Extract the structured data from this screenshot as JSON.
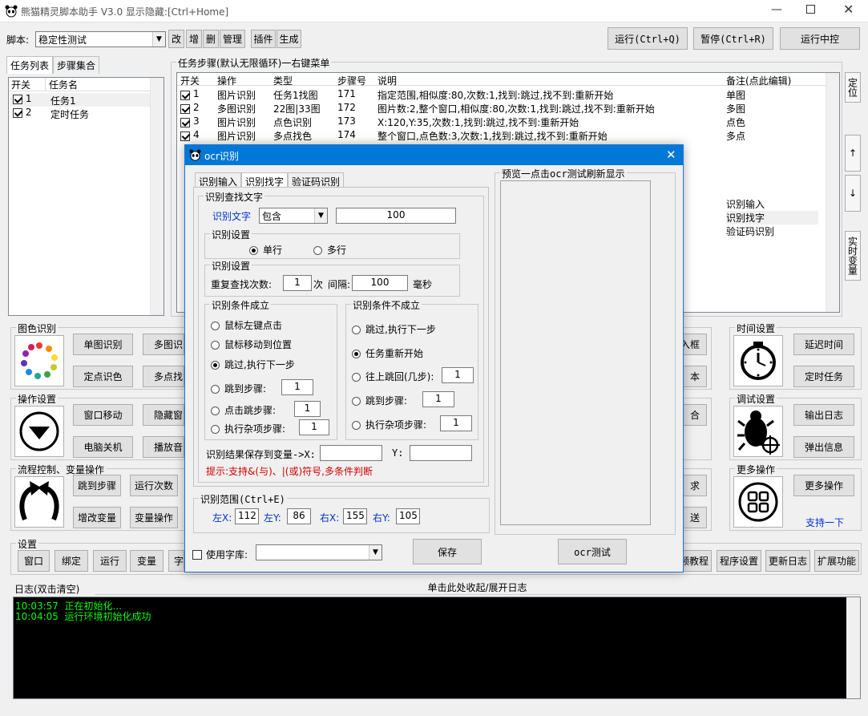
{
  "window": {
    "title": "熊猫精灵脚本助手  V3.0  显示隐藏:[Ctrl+Home]"
  },
  "toolbar": {
    "script_label": "脚本:",
    "script_value": "稳定性测试",
    "buttons": [
      "改",
      "增",
      "删",
      "管理",
      "插件",
      "生成"
    ],
    "run": "运行(Ctrl+Q)",
    "pause": "暂停(Ctrl+R)",
    "stop": "运行中控"
  },
  "left_tabs": [
    "任务列表",
    "步骤集合"
  ],
  "task_list": {
    "headers": [
      "开关",
      "任务名"
    ],
    "rows": [
      {
        "num": "1",
        "name": "任务1",
        "checked": true
      },
      {
        "num": "2",
        "name": "定时任务",
        "checked": true
      }
    ]
  },
  "steps": {
    "group_title": "任务步骤(默认无限循环)一右键菜单",
    "headers": [
      "开关",
      "操作",
      "类型",
      "步骤号",
      "说明",
      "备注(点此编辑)"
    ],
    "rows": [
      {
        "num": "1",
        "op": "图片识别",
        "type": "任务1找图",
        "step": "171",
        "desc": "指定范围,相似度:80,次数:1,找到:跳过,找不到:重新开始",
        "note": "单图"
      },
      {
        "num": "2",
        "op": "多图识别",
        "type": "22图|33图",
        "step": "172",
        "desc": "图片数:2,整个窗口,相似度:80,次数:1,找到:跳过,找不到:重新开始",
        "note": "多图"
      },
      {
        "num": "3",
        "op": "图片识别",
        "type": "点色识别",
        "step": "173",
        "desc": "X:120,Y:35,次数:1,找到:跳过,找不到:重新开始",
        "note": "点色"
      },
      {
        "num": "4",
        "op": "图片识别",
        "type": "多点找色",
        "step": "174",
        "desc": "整个窗口,点色数:3,次数:1,找到:跳过,找不到:重新开始",
        "note": "多点"
      }
    ],
    "extra_notes": [
      "识别输入",
      "识别找字",
      "验证码识别"
    ]
  },
  "side_buttons": {
    "locate": "定位",
    "up": "↑",
    "down": "↓",
    "realtime": "实时变量"
  },
  "sections": {
    "image": {
      "title": "图色识别",
      "buttons": [
        "单图识别",
        "多图识",
        "定点识色",
        "多点找"
      ],
      "right_buttons": [
        "入框",
        "本"
      ]
    },
    "operation": {
      "title": "操作设置",
      "buttons": [
        "窗口移动",
        "隐藏窗",
        "电脑关机",
        "播放音"
      ],
      "right_buttons": [
        "合"
      ]
    },
    "flow": {
      "title": "流程控制、变量操作",
      "buttons": [
        "跳到步骤",
        "运行次数",
        "增改变量",
        "变量操作"
      ],
      "right_buttons": [
        "求",
        "送"
      ]
    },
    "settings": {
      "title": "设置",
      "buttons": [
        "窗口",
        "绑定",
        "运行",
        "变量",
        "字"
      ],
      "right_buttons": [
        "频教程",
        "程序设置",
        "更新日志",
        "扩展功能"
      ]
    },
    "time": {
      "title": "时间设置",
      "buttons": [
        "延迟时间",
        "定时任务"
      ]
    },
    "debug": {
      "title": "调试设置",
      "buttons": [
        "输出日志",
        "弹出信息"
      ]
    },
    "more": {
      "title": "更多操作",
      "button": "更多操作",
      "link": "支持一下"
    }
  },
  "log": {
    "title": "日志(双击清空)",
    "toggle": "单击此处收起/展开日志",
    "lines": [
      "10:03:57  正在初始化...",
      "10:04:05  运行环境初始化成功"
    ]
  },
  "dialog": {
    "title": "ocr识别",
    "tabs": [
      "识别输入",
      "识别找字",
      "验证码识别"
    ],
    "find_text": {
      "title": "识别查找文字",
      "label": "识别文字",
      "mode": "包含",
      "value": "100"
    },
    "lines": {
      "title": "识别设置",
      "options": [
        "单行",
        "多行"
      ],
      "selected": 0
    },
    "repeat": {
      "title": "识别设置",
      "label": "重复查找次数:",
      "count": "1",
      "unit": "次",
      "interval_label": "间隔:",
      "interval": "100",
      "interval_unit": "毫秒"
    },
    "success": {
      "title": "识别条件成立",
      "options": [
        "鼠标左键点击",
        "鼠标移动到位置",
        "跳过,执行下一步",
        "跳到步骤:",
        "点击跳步骤:",
        "执行杂项步骤:"
      ],
      "selected": 2,
      "values": [
        "1",
        "1",
        "1"
      ]
    },
    "fail": {
      "title": "识别条件不成立",
      "options": [
        "跳过,执行下一步",
        "任务重新开始",
        "往上跳回(几步):",
        "跳到步骤:",
        "执行杂项步骤:"
      ],
      "selected": 1,
      "values": [
        "1",
        "1",
        "1"
      ]
    },
    "save_var": {
      "label": "识别结果保存到变量->X:",
      "y_label": "Y:",
      "x": "",
      "y": ""
    },
    "hint": "提示:支持&(与)、|(或)符号,多条件判断",
    "range": {
      "title": "识别范围(Ctrl+E)",
      "left_x_label": "左X:",
      "left_x": "112",
      "left_y_label": "左Y:",
      "left_y": "86",
      "right_x_label": "右X:",
      "right_x": "155",
      "right_y_label": "右Y:",
      "right_y": "105"
    },
    "preview": {
      "title": "预览一点击ocr测试刷新显示"
    },
    "font_lib": {
      "label": "使用字库:",
      "value": ""
    },
    "save": "保存",
    "test": "ocr测试"
  }
}
